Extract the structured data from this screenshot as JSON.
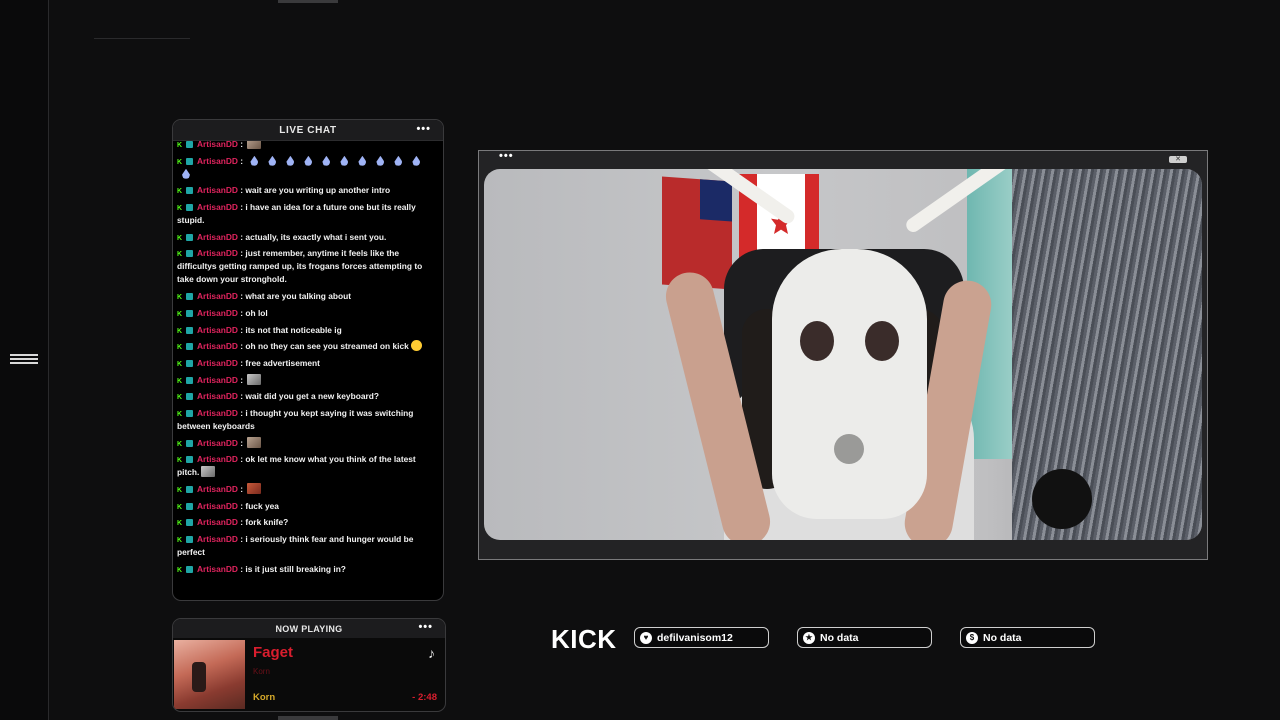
{
  "chat": {
    "title": "LIVE CHAT",
    "menu": "•••",
    "messages": [
      {
        "user": "ArtisanDD",
        "text": "",
        "emote": "image"
      },
      {
        "user": "ArtisanDD",
        "text": "",
        "emote": "drops"
      },
      {
        "user": "ArtisanDD",
        "text": "wait are you writing up another intro"
      },
      {
        "user": "ArtisanDD",
        "text": "i have an idea for a future one but its really stupid."
      },
      {
        "user": "ArtisanDD",
        "text": "actually, its exactly what i sent you."
      },
      {
        "user": "ArtisanDD",
        "text": "just remember, anytime it feels like the difficultys getting ramped up, its frogans forces attempting to take down your stronghold."
      },
      {
        "user": "ArtisanDD",
        "text": "what are you talking about"
      },
      {
        "user": "ArtisanDD",
        "text": "oh lol"
      },
      {
        "user": "ArtisanDD",
        "text": "its not that noticeable ig"
      },
      {
        "user": "ArtisanDD",
        "text": "oh no they can see you streamed on kick",
        "emote": "laugh"
      },
      {
        "user": "ArtisanDD",
        "text": "free advertisement"
      },
      {
        "user": "ArtisanDD",
        "text": "",
        "emote": "mouse"
      },
      {
        "user": "ArtisanDD",
        "text": "wait did you get a new keyboard?"
      },
      {
        "user": "ArtisanDD",
        "text": "i thought you kept saying it was switching between keyboards"
      },
      {
        "user": "ArtisanDD",
        "text": "",
        "emote": "image"
      },
      {
        "user": "ArtisanDD",
        "text": "ok let me know what you think of the latest pitch.",
        "emote": "mouse"
      },
      {
        "user": "ArtisanDD",
        "text": "",
        "emote": "red"
      },
      {
        "user": "ArtisanDD",
        "text": "fuck yea"
      },
      {
        "user": "ArtisanDD",
        "text": "fork knife?"
      },
      {
        "user": "ArtisanDD",
        "text": "i seriously think fear and hunger would be perfect"
      },
      {
        "user": "ArtisanDD",
        "text": "is it just still breaking in?"
      }
    ]
  },
  "now_playing": {
    "title": "NOW PLAYING",
    "menu": "•••",
    "song": "Faget",
    "artist_small": "Korn",
    "artist": "Korn",
    "time": "- 2:48",
    "note_icon": "music-note-icon"
  },
  "video": {
    "dots": "•••",
    "close": "✕"
  },
  "stats": {
    "platform": "KICK",
    "items": [
      {
        "icon": "heart-icon",
        "glyph": "♥",
        "label": "defilvanisom12"
      },
      {
        "icon": "star-icon",
        "glyph": "★",
        "label": "No data"
      },
      {
        "icon": "dollar-icon",
        "glyph": "$",
        "label": "No data"
      }
    ]
  },
  "colors": {
    "username": "#e0245e",
    "kick_green": "#53fc18",
    "song_red": "#d91e2e",
    "artist_gold": "#d4a82a"
  }
}
